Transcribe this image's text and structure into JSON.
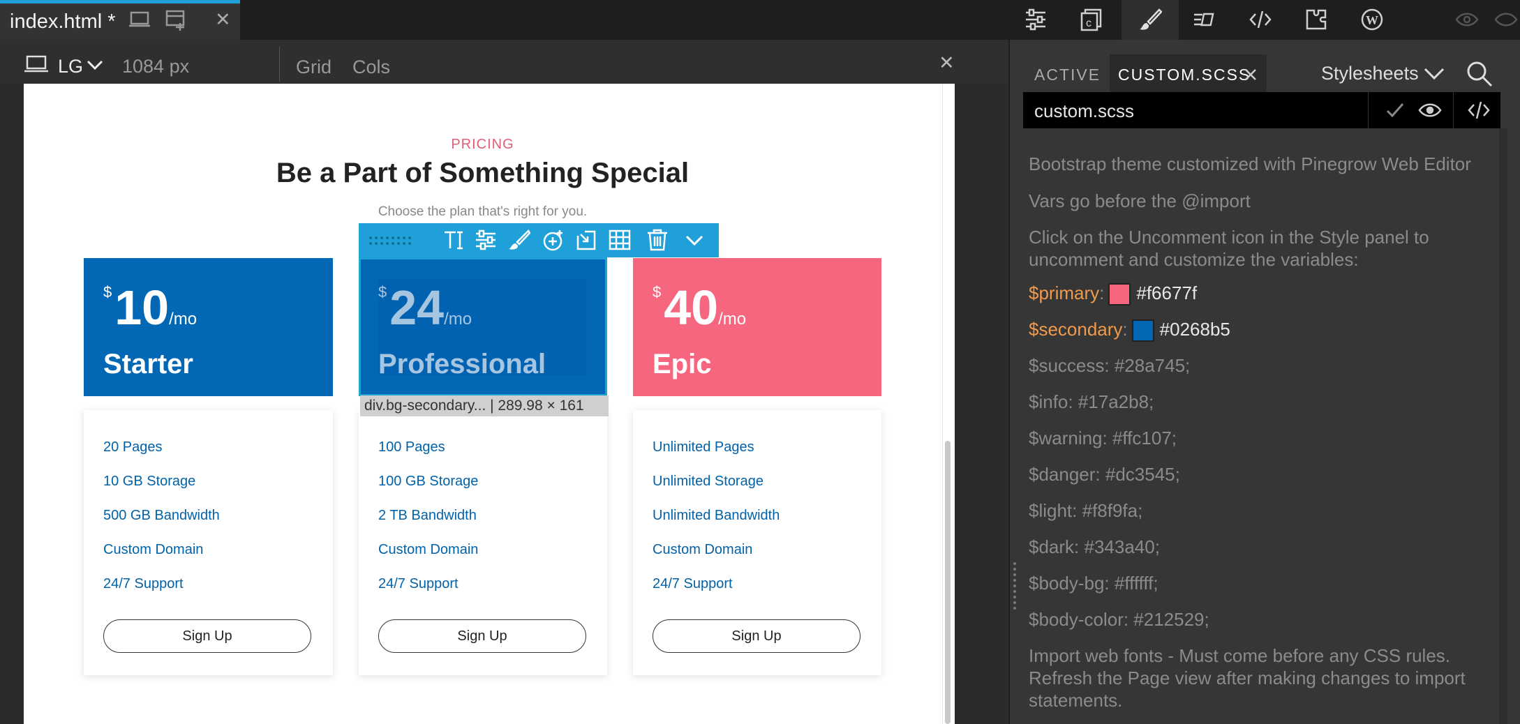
{
  "top_bar": {
    "file_name": "index.html *",
    "close": "✕"
  },
  "canvas_bar": {
    "device": "LG",
    "width": "1084 px",
    "grid": "Grid",
    "cols": "Cols",
    "close": "✕"
  },
  "pricing": {
    "label": "PRICING",
    "title": "Be a Part of Something Special",
    "subtitle": "Choose the plan that's right for you.",
    "plans": [
      {
        "currency": "$",
        "price": "10",
        "unit": "/mo",
        "name": "Starter",
        "color": "#0268b5",
        "features": [
          "20 Pages",
          "10 GB Storage",
          "500 GB Bandwidth",
          "Custom Domain",
          "24/7 Support"
        ],
        "button": "Sign Up"
      },
      {
        "currency": "$",
        "price": "24",
        "unit": "/mo",
        "name": "Professional",
        "color": "#0268b5",
        "features": [
          "100 Pages",
          "100 GB Storage",
          "2 TB Bandwidth",
          "Custom Domain",
          "24/7 Support"
        ],
        "button": "Sign Up"
      },
      {
        "currency": "$",
        "price": "40",
        "unit": "/mo",
        "name": "Epic",
        "color": "#f6677f",
        "features": [
          "Unlimited Pages",
          "Unlimited Storage",
          "Unlimited Bandwidth",
          "Custom Domain",
          "24/7 Support"
        ],
        "button": "Sign Up"
      }
    ]
  },
  "selection": {
    "info": "div.bg-secondary... | 289.98 × 161",
    "accent": "#1fa0d8"
  },
  "right_panel": {
    "tab_active": "ACTIVE",
    "tab_file": "CUSTOM.SCSS",
    "stylesheets": "Stylesheets",
    "sheet_name": "custom.scss",
    "lines": {
      "l1": "Bootstrap theme customized with Pinegrow Web Editor",
      "l2": "Vars go before the @import",
      "l3": "Click on the Uncomment icon in the Style panel to uncomment and customize the variables:",
      "primary_name": "$primary",
      "primary_value": "#f6677f",
      "secondary_name": "$secondary",
      "secondary_value": "#0268b5",
      "success": "$success: #28a745;",
      "info": "$info: #17a2b8;",
      "warning": "$warning: #ffc107;",
      "danger": "$danger: #dc3545;",
      "light": "$light: #f8f9fa;",
      "dark": "$dark: #343a40;",
      "body_bg": "$body-bg: #ffffff;",
      "body_color": "$body-color: #212529;",
      "import": "Import web fonts - Must come before any CSS rules. Refresh the Page view after making changes to import statements."
    }
  }
}
